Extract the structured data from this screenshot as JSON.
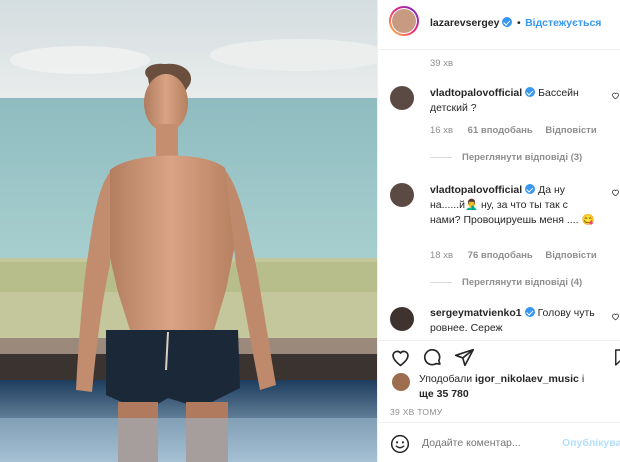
{
  "post": {
    "author": "lazarevsergey",
    "follow_label": "Відстежується",
    "caption_time": "39 хв"
  },
  "comments": [
    {
      "username": "vladtopalovofficial",
      "text": "Бассейн детский ?",
      "time": "16 хв",
      "likes": "61 вподобань",
      "reply_label": "Відповісти",
      "view_replies": "Переглянути відповіді (3)"
    },
    {
      "username": "vladtopalovofficial",
      "text": "Да ну на......й🤦‍♂️ ну, за что ты так с нами? Провоцируешь меня ....",
      "emoji_end": "😋",
      "time": "18 хв",
      "likes": "76 вподобань",
      "reply_label": "Відповісти",
      "view_replies": "Переглянути відповіді (4)"
    },
    {
      "username": "sergeymatvienko1",
      "text": "Голову чуть ровнее. Сереж"
    }
  ],
  "liked_by": {
    "prefix": "Уподобали",
    "user": "igor_nikolaev_music",
    "suffix": "і",
    "line2": "ще 35 780"
  },
  "post_time": "39 ХВ ТОМУ",
  "add_comment": {
    "placeholder": "Додайте коментар...",
    "publish_label": "Опублікува"
  },
  "colors": {
    "accent": "#3897f0",
    "verified": "#3897f0",
    "muted": "#8e8e8e"
  },
  "icons": [
    "heart-icon",
    "comment-icon",
    "share-icon",
    "bookmark-icon",
    "emoji-icon",
    "verified-icon"
  ]
}
